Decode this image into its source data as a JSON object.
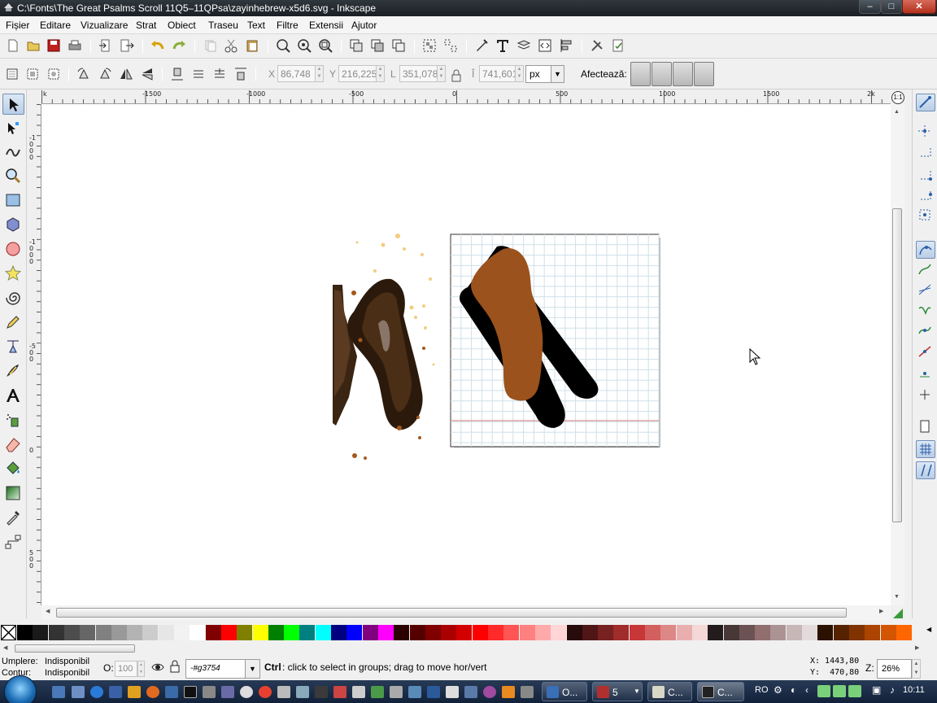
{
  "window": {
    "title": "C:\\Fonts\\The Great Psalms Scroll 11Q5–11QPsa\\zayinhebrew-x5d6.svg - Inkscape",
    "min_label": "–",
    "max_label": "□",
    "close_label": "✕"
  },
  "menu": {
    "items": [
      "Fișier",
      "Editare",
      "Vizualizare",
      "Strat",
      "Obiect",
      "Traseu",
      "Text",
      "Filtre",
      "Extensii",
      "Ajutor"
    ]
  },
  "controls": {
    "x_label": "X",
    "x_value": "86,748",
    "y_label": "Y",
    "y_value": "216,225",
    "w_label": "L",
    "w_value": "351,078",
    "h_label": "Î",
    "h_value": "741,601",
    "unit": "px",
    "affect_label": "Afectează:"
  },
  "rulers": {
    "h_labels": [
      "k",
      "-1500",
      "-1000",
      "-500",
      "0",
      "500",
      "1000",
      "1500",
      "2k"
    ],
    "v_labels": [
      "-1000",
      "-1000",
      "-500",
      "0",
      "500"
    ]
  },
  "palette": {
    "colors": [
      "#000000",
      "#1a1a1a",
      "#333333",
      "#4d4d4d",
      "#666666",
      "#808080",
      "#999999",
      "#b3b3b3",
      "#cccccc",
      "#e6e6e6",
      "#f2f2f2",
      "#ffffff",
      "#800000",
      "#ff0000",
      "#808000",
      "#ffff00",
      "#008000",
      "#00ff00",
      "#008080",
      "#00ffff",
      "#000080",
      "#0000ff",
      "#800080",
      "#ff00ff",
      "#2b0000",
      "#550000",
      "#800000",
      "#aa0000",
      "#d40000",
      "#ff0000",
      "#ff2a2a",
      "#ff5555",
      "#ff8080",
      "#ffaaaa",
      "#ffd5d5",
      "#280b0b",
      "#501616",
      "#782121",
      "#a02c2c",
      "#c83737",
      "#d35f5f",
      "#de8787",
      "#e9afaf",
      "#f4d7d7",
      "#241c1c",
      "#483737",
      "#6c5353",
      "#916f6f",
      "#ac9393",
      "#c8b7b7",
      "#e3dbdb",
      "#2b1100",
      "#552200",
      "#803300",
      "#aa4400",
      "#d45500",
      "#ff6600"
    ]
  },
  "status": {
    "fill_label": "Umplere:",
    "fill_value": "Indisponibil",
    "stroke_label": "Contur:",
    "stroke_value": "Indisponibil",
    "opacity_label": "O:",
    "opacity_value": "100",
    "layer": "-#g3754",
    "message_key": "Ctrl",
    "message": ": click to select in groups; drag to move hor/vert",
    "coord_x": "X: 1443,80",
    "coord_y": "Y:  470,80",
    "zoom_label": "Z:",
    "zoom_value": "26%"
  },
  "taskbar": {
    "tasks": [
      {
        "label": "O...",
        "color": "#3a6fb8"
      },
      {
        "label": "5",
        "color": "#b03030"
      },
      {
        "label": "C...",
        "color": "#d8d8c8"
      },
      {
        "label": "C...",
        "color": "#222222"
      }
    ],
    "lang": "RO",
    "clock": "10:11"
  }
}
